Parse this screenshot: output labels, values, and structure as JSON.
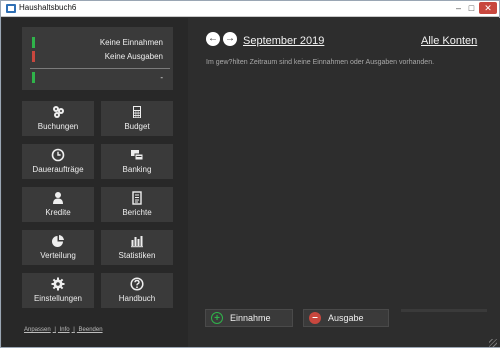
{
  "window": {
    "title": "Haushaltsbuch6",
    "controls": {
      "minimize": "–",
      "maximize": "□",
      "close": "✕"
    }
  },
  "summary": {
    "income": {
      "text": "Keine Einnahmen",
      "color": "#2fb34a"
    },
    "expenses": {
      "text": "Keine Ausgaben",
      "color": "#c8473e"
    },
    "balance": {
      "text": "-",
      "color": "#2fb34a"
    }
  },
  "nav": {
    "buchungen": {
      "label": "Buchungen",
      "icon": "coins-icon"
    },
    "budget": {
      "label": "Budget",
      "icon": "calculator-icon"
    },
    "dauerauftraege": {
      "label": "Daueraufträge",
      "icon": "clock-icon"
    },
    "banking": {
      "label": "Banking",
      "icon": "bank-transfer-icon"
    },
    "kredite": {
      "label": "Kredite",
      "icon": "person-icon"
    },
    "berichte": {
      "label": "Berichte",
      "icon": "report-icon"
    },
    "verteilung": {
      "label": "Verteilung",
      "icon": "pie-chart-icon"
    },
    "statistiken": {
      "label": "Statistiken",
      "icon": "bar-chart-icon"
    },
    "einstellungen": {
      "label": "Einstellungen",
      "icon": "gear-icon"
    },
    "handbuch": {
      "label": "Handbuch",
      "icon": "help-icon"
    }
  },
  "footer": {
    "links": [
      "Anpassen",
      "Info",
      "Beenden"
    ],
    "separator": "|"
  },
  "header": {
    "prev": "←",
    "next": "→",
    "period": "September 2019",
    "accounts": "Alle Konten"
  },
  "message": "Im gew?hlten Zeitraum sind keine Einnahmen oder Ausgaben vorhanden.",
  "actions": {
    "income": {
      "label": "Einnahme",
      "symbol": "+",
      "color": "#2fb34a"
    },
    "expense": {
      "label": "Ausgabe",
      "symbol": "–",
      "color": "#c8473e"
    }
  }
}
